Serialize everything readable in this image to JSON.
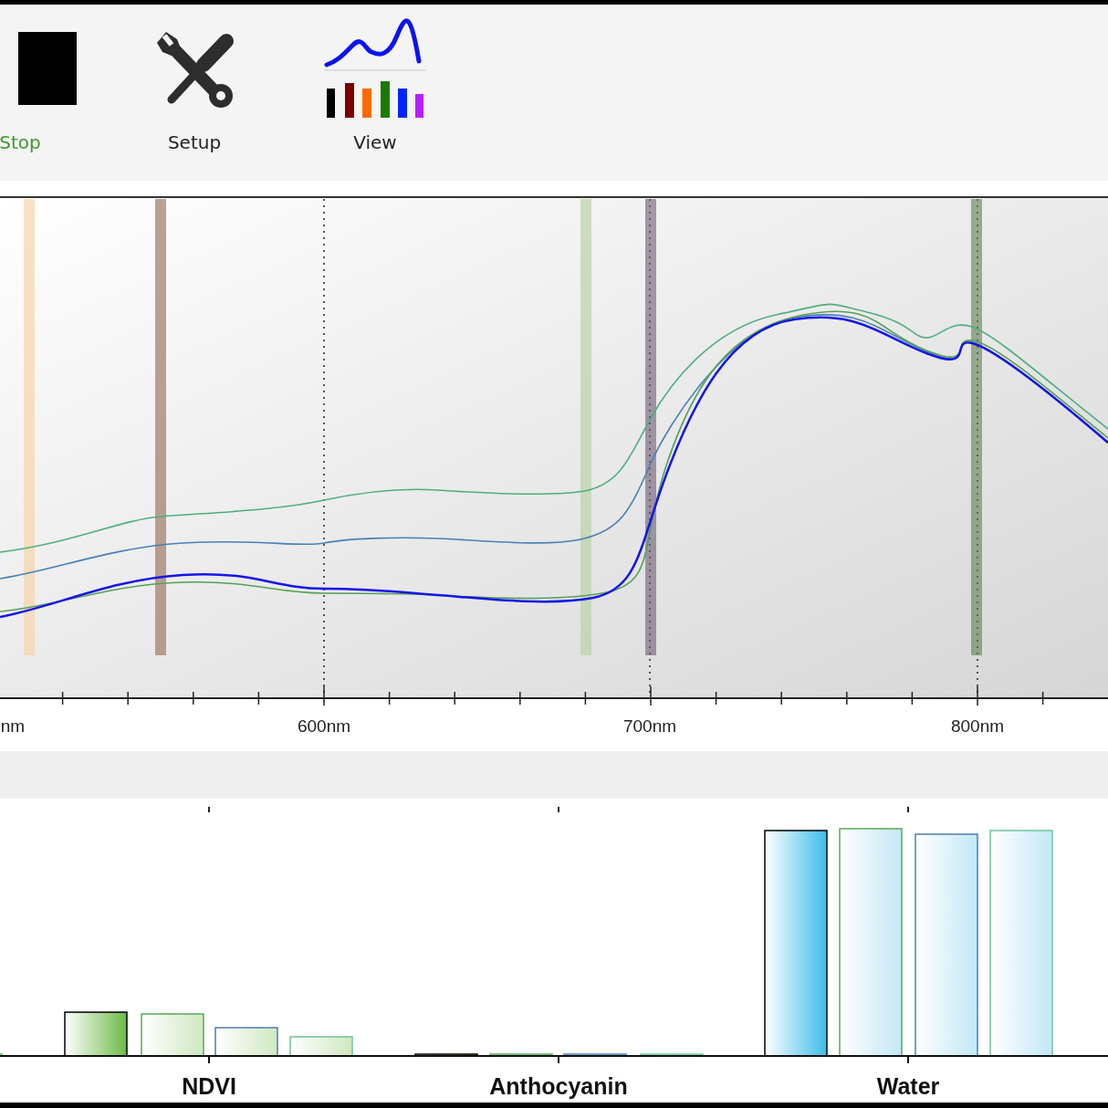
{
  "toolbar": {
    "buttons": [
      {
        "label": "Stop",
        "kind": "stop",
        "color": "#3f9a2c"
      },
      {
        "label": "Setup",
        "kind": "tools",
        "color": "#222222"
      },
      {
        "label": "View",
        "kind": "view",
        "color": "#222222"
      }
    ]
  },
  "spectrum": {
    "x_labels": [
      "nm",
      "600nm",
      "700nm",
      "800nm"
    ]
  },
  "indices": {
    "categories": [
      "NDVI",
      "Anthocyanin",
      "Water"
    ]
  }
}
